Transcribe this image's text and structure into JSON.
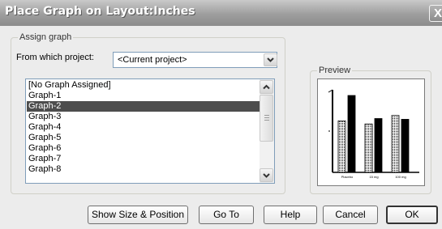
{
  "window": {
    "title": "Place Graph on Layout:Inches",
    "close_glyph": "X"
  },
  "assign_group": {
    "legend": "Assign graph",
    "project_label": "From which project:",
    "project_value": "<Current project>"
  },
  "graph_list": {
    "items": [
      "[No Graph Assigned]",
      "Graph-1",
      "Graph-2",
      "Graph-3",
      "Graph-4",
      "Graph-5",
      "Graph-6",
      "Graph-7",
      "Graph-8"
    ],
    "selected_index": 2
  },
  "preview": {
    "legend": "Preview",
    "thumbnail": {
      "bars": [
        {
          "fill": "dotted",
          "value": 0.67
        },
        {
          "fill": "black",
          "value": 1.0
        },
        {
          "fill": "dotted",
          "value": 0.63
        },
        {
          "fill": "black",
          "value": 0.7
        },
        {
          "fill": "dotted",
          "value": 0.74
        },
        {
          "fill": "black",
          "value": 0.69
        }
      ],
      "category_labels": [
        "Placebo",
        "15 mg",
        "100 mg"
      ]
    }
  },
  "buttons": {
    "show_size": "Show Size & Position",
    "go_to": "Go To",
    "help": "Help",
    "cancel": "Cancel",
    "ok": "OK"
  },
  "icons": {
    "dropdown_arrow": "chevron-down-icon",
    "scroll_up": "scroll-up-arrow-icon",
    "scroll_down": "scroll-down-arrow-icon",
    "close": "close-icon"
  },
  "colors": {
    "titlebar": "#9e9e9e",
    "selection": "#4d4d4d",
    "dialog_bg": "#ececec"
  }
}
